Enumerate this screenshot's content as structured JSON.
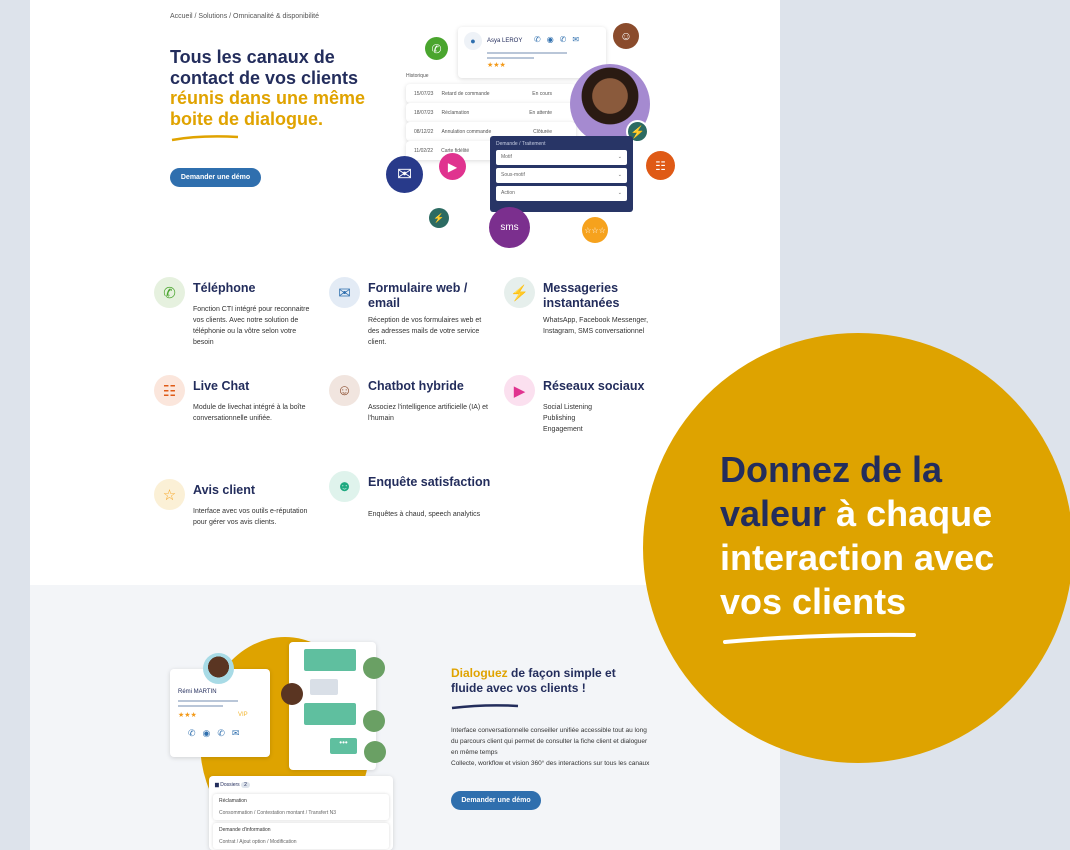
{
  "breadcrumb": "Accueil / Solutions / Omnicanalité & disponibilité",
  "hero": {
    "title_1": "Tous les canaux de contact de vos clients",
    "title_2": "réunis dans une même boite de dialogue.",
    "cta": "Demander une démo"
  },
  "mock": {
    "contact_name": "Asya LEROY",
    "history_label": "Historique",
    "history": [
      {
        "date": "15/07/23",
        "subject": "Retard de commande",
        "status": "En cours"
      },
      {
        "date": "18/07/23",
        "subject": "Réclamation",
        "status": "En attente"
      },
      {
        "date": "08/12/22",
        "subject": "Annulation commande",
        "status": "Clôturée"
      },
      {
        "date": "11/02/22",
        "subject": "Carte fidélité",
        "status": ""
      }
    ],
    "form_title": "Demande / Traitement",
    "fields": [
      "Motif",
      "Sous-motif",
      "Action"
    ],
    "sms": "sms"
  },
  "features": [
    {
      "title": "Téléphone",
      "desc": "Fonction CTI intégré pour reconnaitre vos clients. Avec notre solution de téléphonie ou la vôtre selon votre besoin",
      "icon": "phone-icon"
    },
    {
      "title": "Formulaire web / email",
      "desc": "Réception de vos formulaires web et des adresses mails de votre service client.",
      "icon": "mail-icon"
    },
    {
      "title": "Messageries instantanées",
      "desc": "WhatsApp, Facebook Messenger, Instagram, SMS conversationnel",
      "icon": "messaging-icon"
    },
    {
      "title": "Live Chat",
      "desc": "Module de livechat intégré à la boîte conversationnelle unifiée.",
      "icon": "livechat-icon"
    },
    {
      "title": "Chatbot hybride",
      "desc": "Associez l'intelligence artificielle (IA) et l'humain",
      "icon": "robot-icon"
    },
    {
      "title": "Réseaux sociaux",
      "desc": "Social Listening\nPublishing\nEngagement",
      "icon": "social-icon"
    },
    {
      "title": "Avis client",
      "desc": "Interface avec vos outils e-réputation pour gérer vos avis clients.",
      "icon": "stars-icon"
    },
    {
      "title": "Enquête satisfaction",
      "desc": "Enquêtes à chaud, speech analytics",
      "icon": "smiley-icon"
    }
  ],
  "overlay": {
    "line1": "Donnez de la",
    "line2a": "valeur",
    "line2b": " à chaque",
    "line3": "interaction avec",
    "line4": "vos clients"
  },
  "dialog": {
    "title_gold": "Dialoguez",
    "title_rest": " de façon simple et fluide avec vos clients !",
    "desc": "Interface conversationnelle conseiller unifiée accessible tout au long du parcours client qui permet de consulter la fiche client et dialoguer en même temps\nCollecte, workflow et vision 360° des interactions sur tous les canaux",
    "cta": "Demander une démo",
    "contact_name": "Rémi MARTIN",
    "vip": "VIP",
    "folders_label": "Dossiers",
    "folders_count": "2",
    "folders": [
      {
        "name": "Réclamation",
        "path": "Consommation / Contestation montant / Transfert N3"
      },
      {
        "name": "Demande d'information",
        "path": "Contrat / Ajout option / Modification"
      }
    ]
  },
  "colors": {
    "navy": "#232d5c",
    "gold": "#dea300",
    "blue": "#2f6fae"
  }
}
